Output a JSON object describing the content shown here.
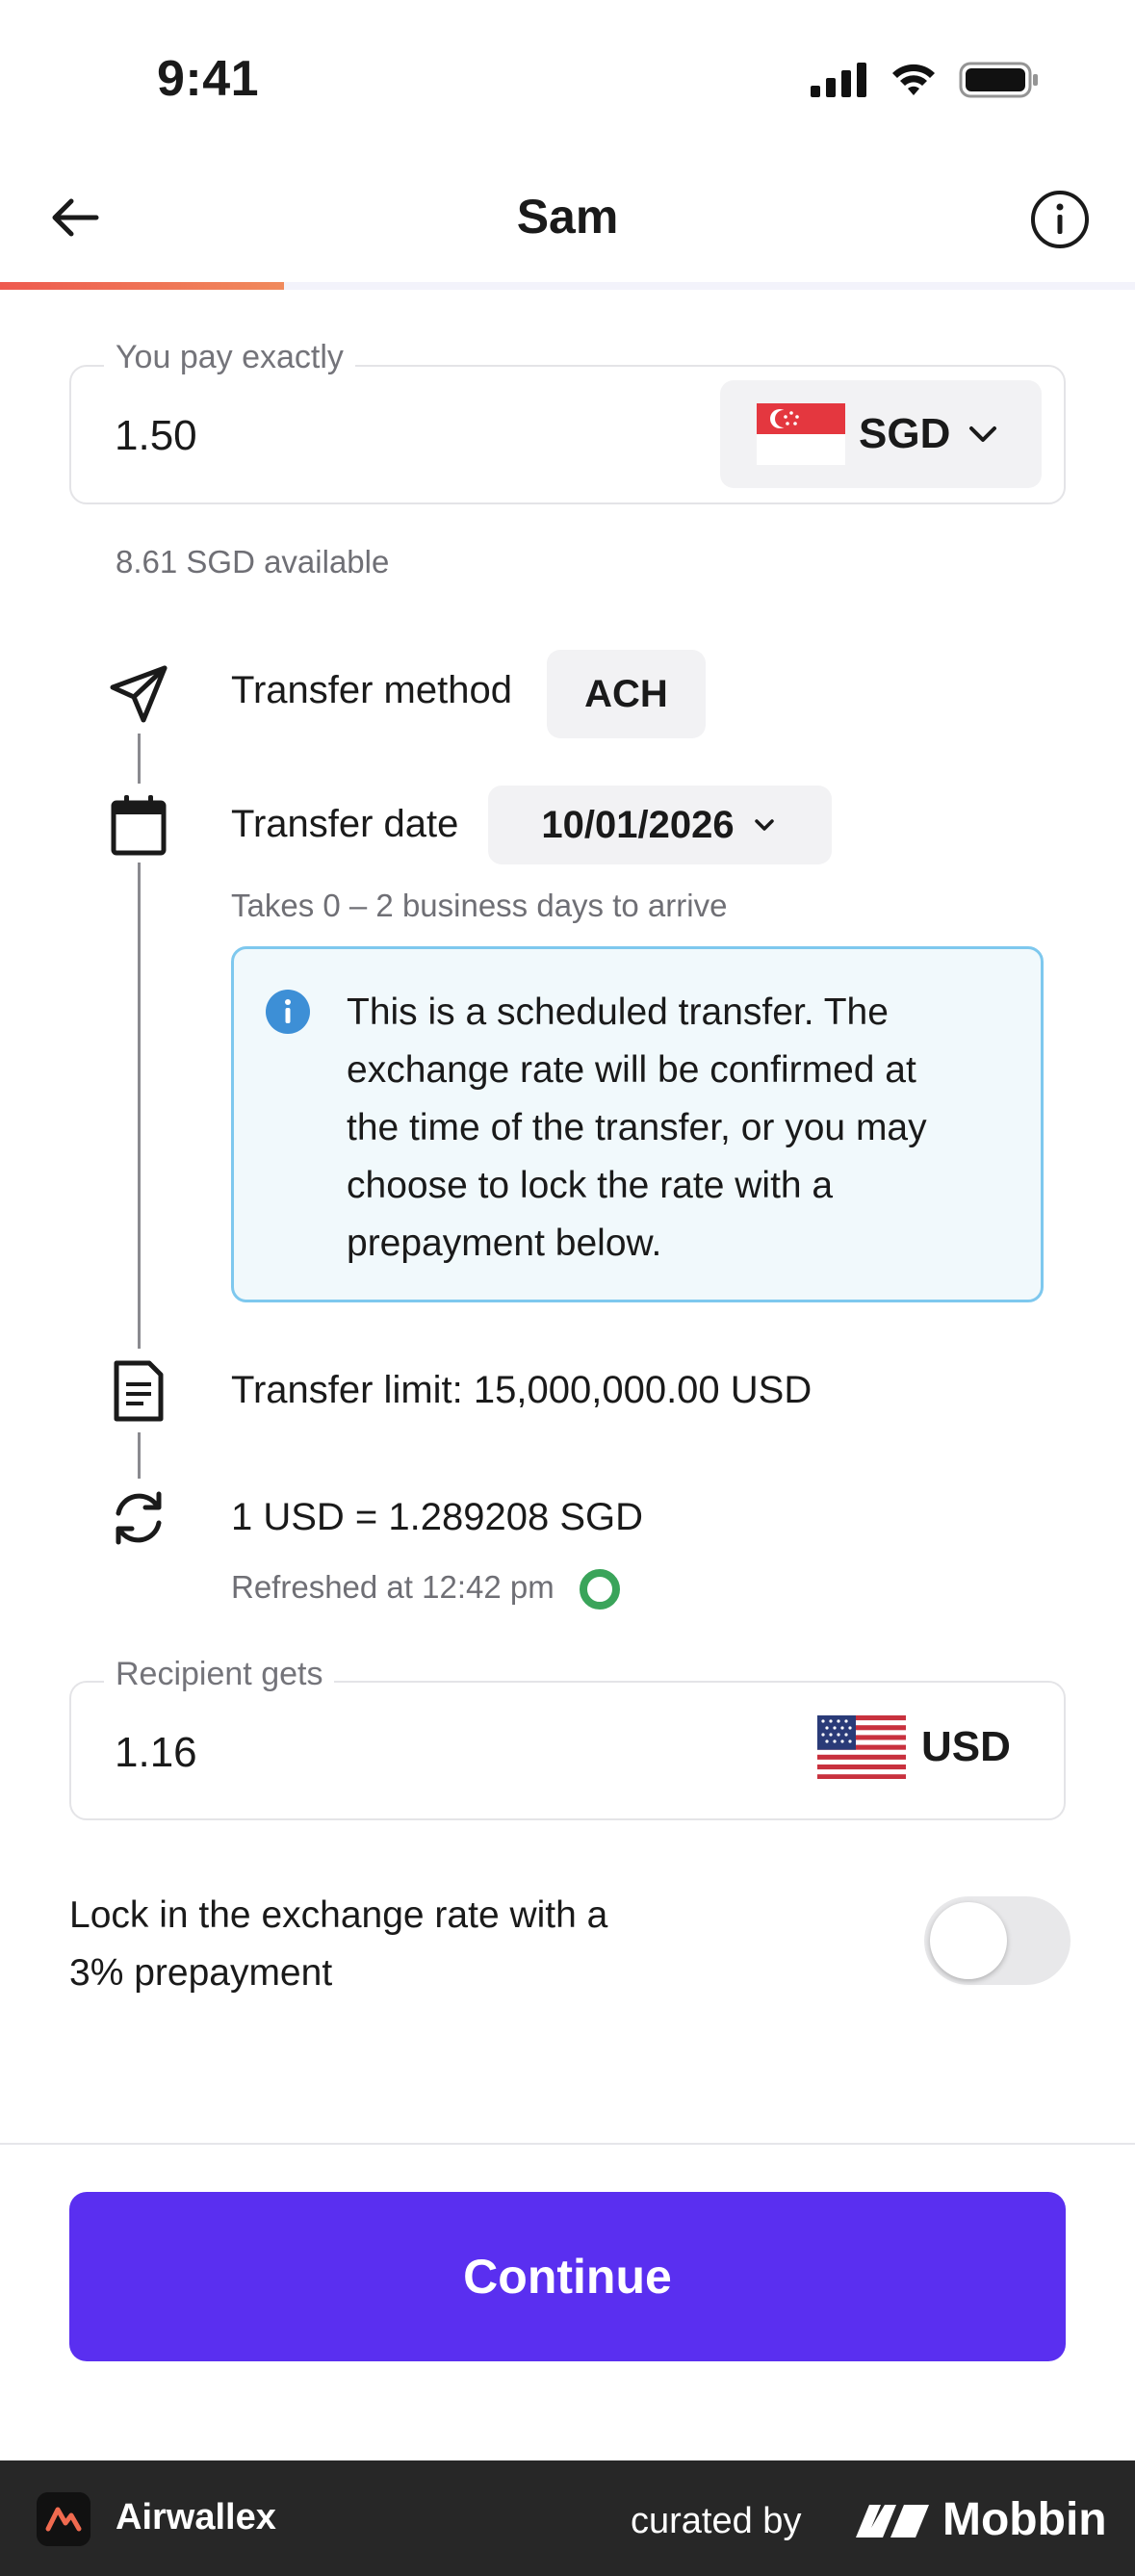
{
  "status": {
    "time": "9:41"
  },
  "header": {
    "title": "Sam"
  },
  "progress": {
    "fraction": 0.25
  },
  "pay": {
    "legend": "You pay exactly",
    "amount": "1.50",
    "currency": "SGD",
    "available": "8.61 SGD available"
  },
  "transfer": {
    "method_label": "Transfer method",
    "method_value": "ACH",
    "date_label": "Transfer date",
    "date_value": "10/01/2026",
    "arrival": "Takes 0 – 2 business days to arrive",
    "notice": "This is a scheduled transfer. The exchange rate will be confirmed at the time of the transfer, or you may choose to lock the rate with a prepayment below.",
    "limit": "Transfer limit: 15,000,000.00 USD",
    "rate": "1 USD = 1.289208 SGD",
    "refreshed": "Refreshed at 12:42 pm"
  },
  "receive": {
    "legend": "Recipient gets",
    "amount": "1.16",
    "currency": "USD"
  },
  "lock": {
    "label": "Lock in the exchange rate with a 3% prepayment",
    "enabled": false
  },
  "cta": {
    "label": "Continue"
  },
  "footer": {
    "app": "Airwallex",
    "curated": "curated by",
    "brand": "Mobbin"
  },
  "colors": {
    "accent": "#5a2ff0",
    "progress": "#ee5a4f",
    "notice_border": "#7ec8ee",
    "info_icon": "#3d8fd6",
    "refresh_ring": "#3aa45a"
  },
  "icons": [
    "arrow-left-icon",
    "info-circle-icon",
    "chevron-down-icon",
    "paper-plane-icon",
    "calendar-icon",
    "info-icon",
    "document-icon",
    "refresh-icon",
    "refresh-timer-icon",
    "sg-flag-icon",
    "us-flag-icon",
    "signal-icon",
    "wifi-icon",
    "battery-icon"
  ]
}
